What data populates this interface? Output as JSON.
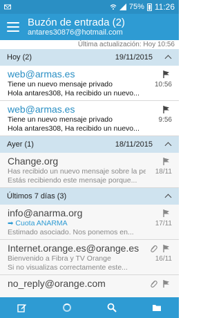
{
  "statusbar": {
    "battery": "75%",
    "time": "11:26"
  },
  "appbar": {
    "title": "Buzón de entrada (2)",
    "account": "antares30876@hotmail.com"
  },
  "last_update": "Última actualización:  Hoy 10:56",
  "sections": [
    {
      "name": "Hoy (2)",
      "date": "19/11/2015",
      "mails": [
        {
          "from": "web@armas.es",
          "subject": "Tiene un nuevo mensaje privado",
          "preview": "Hola antares308, Ha recibido un nuevo...",
          "date": "10:56",
          "read": false
        },
        {
          "from": "web@armas.es",
          "subject": "Tiene un nuevo mensaje privado",
          "preview": "Hola antares308, Ha recibido un nuevo...",
          "date": "9:56",
          "read": false
        }
      ]
    },
    {
      "name": "Ayer (1)",
      "date": "18/11/2015",
      "mails": [
        {
          "from": "Change.org",
          "subject": "Has recibido un nuevo mensaje sobre la petici...",
          "preview": "Estás recibiendo este mensaje porque...",
          "date": "18/11",
          "read": true
        }
      ]
    },
    {
      "name": "Últimos 7 días (3)",
      "date": "",
      "mails": [
        {
          "from": "info@anarma.org",
          "subject": "Cuota ANARMA",
          "preview": "Estimado asociado. Nos ponemos en...",
          "date": "17/11",
          "read": true,
          "forwarded": true
        },
        {
          "from": "Internet.orange.es@orange.es",
          "subject": "Bienvenido a Fibra y TV Orange",
          "preview": "Si no visualizas correctamente este...",
          "date": "16/11",
          "read": true,
          "attachment": true
        },
        {
          "from": "no_reply@orange.com",
          "subject": "",
          "preview": "",
          "date": "",
          "read": true,
          "attachment": true
        }
      ]
    }
  ]
}
